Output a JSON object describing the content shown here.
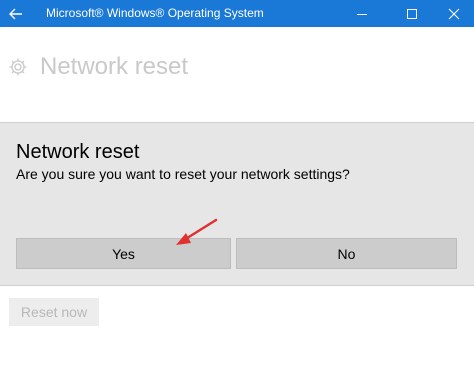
{
  "window": {
    "title": "Microsoft® Windows® Operating System",
    "title_bar_color": "#1a78d6"
  },
  "icons": {
    "back": "back-arrow-icon",
    "minimize": "minimize-icon",
    "maximize": "maximize-icon",
    "close": "close-icon",
    "settings": "gear-icon",
    "annotation": "red-arrow-icon"
  },
  "page": {
    "title": "Network reset",
    "reset_button_label": "Reset now"
  },
  "dialog": {
    "title": "Network reset",
    "message": "Are you sure you want to reset your network settings?",
    "yes_label": "Yes",
    "no_label": "No"
  },
  "colors": {
    "annotation_arrow": "#e03131",
    "dialog_background": "#e6e6e6",
    "button_background": "#cccccc"
  }
}
